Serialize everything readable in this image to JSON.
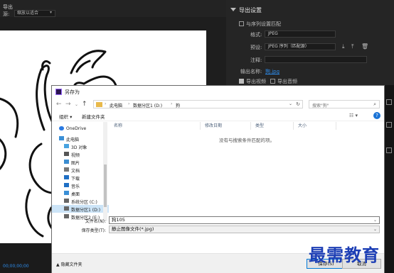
{
  "background": {
    "menu_label": "导出",
    "scale_label": "源:",
    "scale_value": "缩放以适合",
    "timecode": "00;00;00;00",
    "export_settings": {
      "title": "导出设置",
      "match_sequence_label": "与序列设置匹配",
      "format_label": "格式:",
      "format_value": "JPEG",
      "preset_label": "预设:",
      "preset_value": "JPEG 序列（匹配源）",
      "comment_label": "注释:",
      "output_name_label": "输出名称:",
      "output_name_value": "狗.jpg",
      "export_video_label": "导出视频",
      "export_audio_label": "导出音频"
    }
  },
  "dialog": {
    "title": "另存为",
    "address": {
      "crumbs": [
        "此电脑",
        "数据分区1 (D:)",
        "狗"
      ]
    },
    "search_placeholder": "搜索\"狗\"",
    "toolbar": {
      "organize_label": "组织 ▾",
      "new_folder_label": "新建文件夹"
    },
    "nav_items": [
      {
        "label": "OneDrive",
        "icon": "cloud-icon",
        "color": "#2a7ae2"
      },
      {
        "label": "此电脑",
        "icon": "computer-icon",
        "color": "#3a8fd6"
      },
      {
        "label": "3D 对象",
        "icon": "cube-icon",
        "color": "#47a3e0"
      },
      {
        "label": "视频",
        "icon": "video-icon",
        "color": "#555555"
      },
      {
        "label": "图片",
        "icon": "picture-icon",
        "color": "#3b8dd0"
      },
      {
        "label": "文档",
        "icon": "document-icon",
        "color": "#777777"
      },
      {
        "label": "下载",
        "icon": "download-icon",
        "color": "#1f6fc4"
      },
      {
        "label": "音乐",
        "icon": "music-icon",
        "color": "#1f6fc4"
      },
      {
        "label": "桌面",
        "icon": "desktop-icon",
        "color": "#3a8fd6"
      },
      {
        "label": "系统分区 (C:)",
        "icon": "drive-icon",
        "color": "#666666"
      },
      {
        "label": "数据分区1 (D:)",
        "icon": "drive-icon",
        "color": "#666666"
      },
      {
        "label": "数据分区2 (E:)",
        "icon": "drive-icon",
        "color": "#666666"
      }
    ],
    "columns": [
      "名称",
      "修改日期",
      "类型",
      "大小"
    ],
    "empty_message": "没有与搜索条件匹配的项。",
    "file_name_label": "文件名(N):",
    "file_name_value": "狗105",
    "file_type_label": "保存类型(T):",
    "file_type_value": "静止图像文件(*.jpg)",
    "hide_folders_label": "▲ 隐藏文件夹",
    "save_label": "保存(S)",
    "cancel_label": "取消"
  },
  "watermark_text": "最需教育",
  "colors": {
    "accent": "#0078d7",
    "link_blue": "#2d8ceb",
    "watermark": "#1d3fb5"
  }
}
